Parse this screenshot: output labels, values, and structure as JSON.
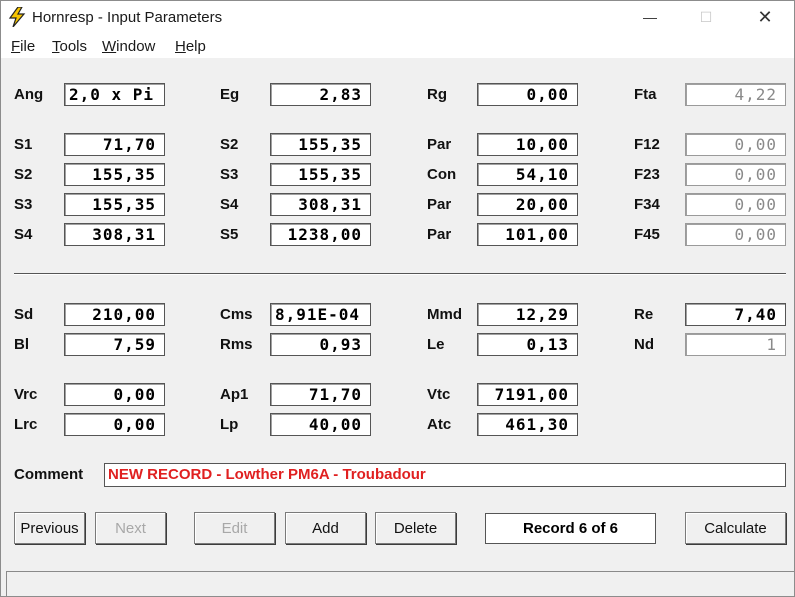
{
  "window": {
    "title": "Hornresp - Input Parameters",
    "minimize_glyph": "—",
    "maximize_glyph": "☐",
    "close_glyph": "✕"
  },
  "menu": {
    "file": "File",
    "tools": "Tools",
    "window": "Window",
    "help": "Help"
  },
  "top": {
    "ang_label": "Ang",
    "ang_value": "2,0 x Pi",
    "eg_label": "Eg",
    "eg_value": "2,83",
    "rg_label": "Rg",
    "rg_value": "0,00",
    "fta_label": "Fta",
    "fta_value": "4,22"
  },
  "horn": {
    "rows": [
      {
        "c1_label": "S1",
        "c1_value": "71,70",
        "c2_label": "S2",
        "c2_value": "155,35",
        "c3_label": "Par",
        "c3_value": "10,00",
        "c4_label": "F12",
        "c4_value": "0,00"
      },
      {
        "c1_label": "S2",
        "c1_value": "155,35",
        "c2_label": "S3",
        "c2_value": "155,35",
        "c3_label": "Con",
        "c3_value": "54,10",
        "c4_label": "F23",
        "c4_value": "0,00"
      },
      {
        "c1_label": "S3",
        "c1_value": "155,35",
        "c2_label": "S4",
        "c2_value": "308,31",
        "c3_label": "Par",
        "c3_value": "20,00",
        "c4_label": "F34",
        "c4_value": "0,00"
      },
      {
        "c1_label": "S4",
        "c1_value": "308,31",
        "c2_label": "S5",
        "c2_value": "1238,00",
        "c3_label": "Par",
        "c3_value": "101,00",
        "c4_label": "F45",
        "c4_value": "0,00"
      }
    ]
  },
  "driver": {
    "sd_label": "Sd",
    "sd_value": "210,00",
    "cms_label": "Cms",
    "cms_value": "8,91E-04",
    "mmd_label": "Mmd",
    "mmd_value": "12,29",
    "re_label": "Re",
    "re_value": "7,40",
    "bl_label": "Bl",
    "bl_value": "7,59",
    "rms_label": "Rms",
    "rms_value": "0,93",
    "le_label": "Le",
    "le_value": "0,13",
    "nd_label": "Nd",
    "nd_value": "1"
  },
  "chambers": {
    "vrc_label": "Vrc",
    "vrc_value": "0,00",
    "ap1_label": "Ap1",
    "ap1_value": "71,70",
    "vtc_label": "Vtc",
    "vtc_value": "7191,00",
    "lrc_label": "Lrc",
    "lrc_value": "0,00",
    "lp_label": "Lp",
    "lp_value": "40,00",
    "atc_label": "Atc",
    "atc_value": "461,30"
  },
  "comment": {
    "label": "Comment",
    "value": "NEW RECORD - Lowther PM6A - Troubadour"
  },
  "buttons": {
    "previous": "Previous",
    "next": "Next",
    "edit": "Edit",
    "add": "Add",
    "delete": "Delete",
    "record": "Record 6 of 6",
    "calculate": "Calculate"
  },
  "colors": {
    "comment_text": "#e02020",
    "icon_bolt": "#f5c400"
  }
}
